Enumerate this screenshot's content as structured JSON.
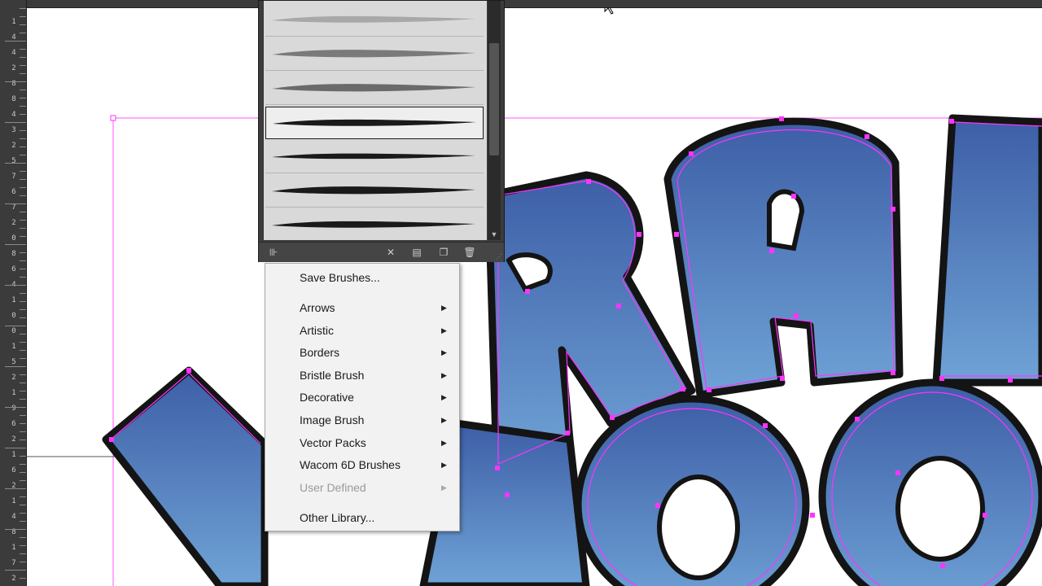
{
  "rulers": {
    "left_labels": [
      "1",
      "4",
      "4",
      "2",
      "8",
      "8",
      "4",
      "3",
      "2",
      "5",
      "7",
      "6",
      "7",
      "2",
      "0",
      "8",
      "6",
      "4",
      "1",
      "0",
      "0",
      "1",
      "5",
      "2",
      "1",
      "9",
      "6",
      "2",
      "1",
      "6",
      "2",
      "1",
      "4",
      "8",
      "1",
      "7",
      "2"
    ]
  },
  "brushes_panel": {
    "selected_index": 3,
    "brush_count": 7,
    "bottom_icons": [
      "brush-libraries-menu-icon",
      "remove-stroke-icon",
      "brush-options-icon",
      "new-brush-icon",
      "delete-brush-icon"
    ],
    "bottom_glyphs": {
      "libraries": "⊪",
      "remove": "✕",
      "options": "▤",
      "new": "❐",
      "delete": "🗑"
    },
    "scroll_down_glyph": "▼"
  },
  "menu": {
    "save": "Save Brushes...",
    "items": [
      {
        "label": "Arrows",
        "submenu": true,
        "enabled": true
      },
      {
        "label": "Artistic",
        "submenu": true,
        "enabled": true
      },
      {
        "label": "Borders",
        "submenu": true,
        "enabled": true
      },
      {
        "label": "Bristle Brush",
        "submenu": true,
        "enabled": true
      },
      {
        "label": "Decorative",
        "submenu": true,
        "enabled": true
      },
      {
        "label": "Image Brush",
        "submenu": true,
        "enabled": true
      },
      {
        "label": "Vector Packs",
        "submenu": true,
        "enabled": true
      },
      {
        "label": "Wacom 6D Brushes",
        "submenu": true,
        "enabled": true
      },
      {
        "label": "User Defined",
        "submenu": true,
        "enabled": false
      }
    ],
    "other": "Other Library...",
    "submenu_glyph": "▶"
  },
  "colors": {
    "selection": "#ff33ff",
    "fill_top": "#3d5ea6",
    "fill_bottom": "#6fa3d6",
    "outline": "#141414",
    "panel_bg": "#3c3c3c",
    "menu_bg": "#f2f2f2"
  }
}
